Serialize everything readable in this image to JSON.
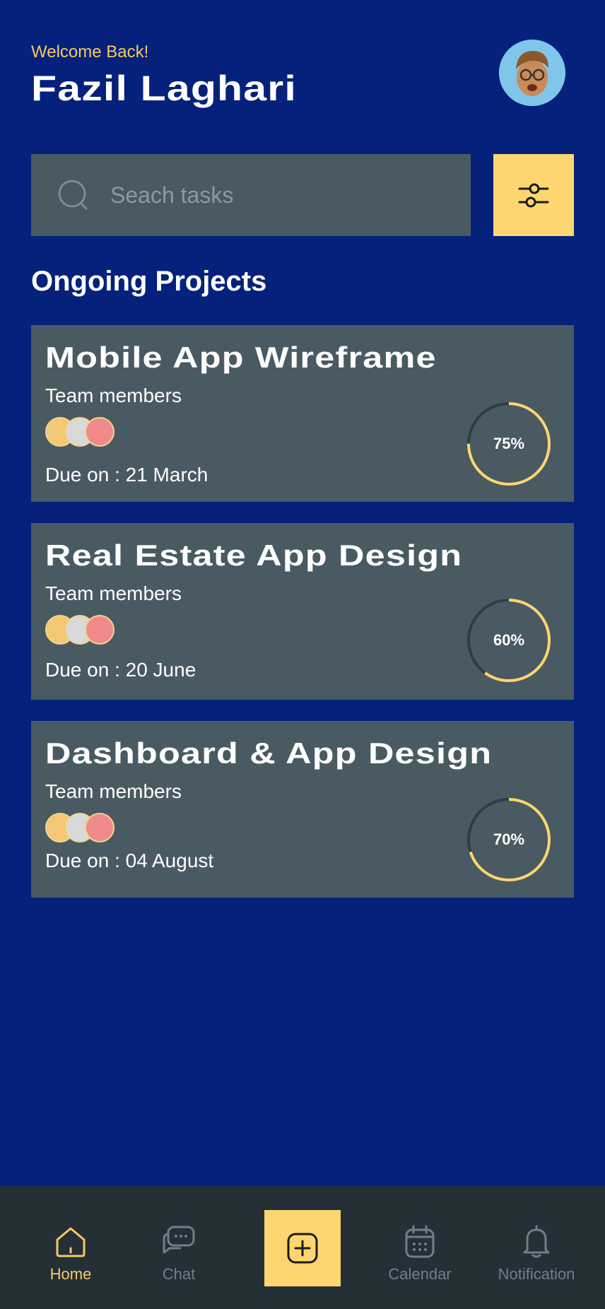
{
  "header": {
    "welcome": "Welcome Back!",
    "user_name": "Fazil Laghari"
  },
  "search": {
    "placeholder": "Seach tasks"
  },
  "section_title": "Ongoing Projects",
  "projects": [
    {
      "title": "Mobile App Wireframe",
      "team_label": "Team members",
      "due": "Due on : 21 March",
      "progress_label": "75%",
      "progress": 0.75
    },
    {
      "title": "Real Estate App Design",
      "team_label": "Team members",
      "due": "Due on : 20 June",
      "progress_label": "60%",
      "progress": 0.6
    },
    {
      "title": "Dashboard & App Design",
      "team_label": "Team members",
      "due": "Due on : 04 August",
      "progress_label": "70%",
      "progress": 0.7
    }
  ],
  "nav": {
    "home": "Home",
    "chat": "Chat",
    "calendar": "Calendar",
    "notification": "Notification"
  },
  "colors": {
    "background": "#06217c",
    "accent": "#fed66f",
    "card": "#4a5a62",
    "nav_background": "#252f36",
    "progress_track": "#2f3e45"
  }
}
